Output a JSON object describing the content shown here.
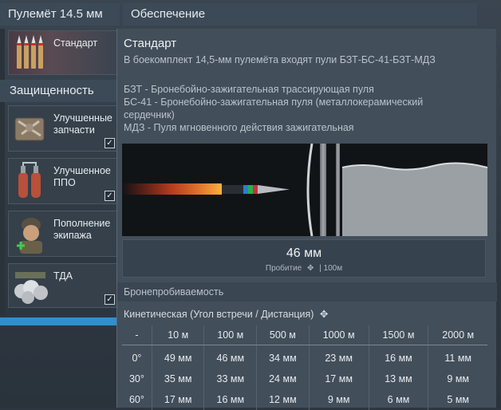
{
  "header": {
    "weapon_title": "Пулемёт 14.5 мм",
    "supply_title": "Обеспечение"
  },
  "belt": {
    "label": "Стандарт"
  },
  "protection": {
    "title": "Защищенность",
    "items": [
      {
        "label": "Улучшенные\nзапчасти",
        "icon": "repair-kit-icon",
        "checked": true
      },
      {
        "label": "Улучшенное\nППО",
        "icon": "fire-extinguisher-icon",
        "checked": true
      },
      {
        "label": "Пополнение\nэкипажа",
        "icon": "crew-replenish-icon",
        "checked": false
      },
      {
        "label": "ТДА",
        "icon": "smoke-system-icon",
        "checked": true
      }
    ]
  },
  "tooltip": {
    "title": "Стандарт",
    "subtitle": "В боекомплект 14,5-мм пулемёта входят пули БЗТ-БС-41-БЗТ-МДЗ",
    "desc": [
      "БЗТ - Бронебойно-зажигательная трассирующая пуля",
      "БС-41 - Бронебойно-зажигательная пуля (металлокерамический\nсердечник)",
      "МДЗ - Пуля мгновенного действия зажигательная"
    ],
    "penetration_value": "46 мм",
    "penetration_caption_left": "Пробитие",
    "penetration_caption_right": "| 100м",
    "armor_title": "Бронепробиваемость",
    "kinetic_title": "Кинетическая (Угол встречи / Дистанция)",
    "table": {
      "headers": [
        "-",
        "10 м",
        "100 м",
        "500 м",
        "1000 м",
        "1500 м",
        "2000 м"
      ],
      "rows": [
        [
          "0°",
          "49 мм",
          "46 мм",
          "34 мм",
          "23 мм",
          "16 мм",
          "11 мм"
        ],
        [
          "30°",
          "35 мм",
          "33 мм",
          "24 мм",
          "17 мм",
          "13 мм",
          "9 мм"
        ],
        [
          "60°",
          "17 мм",
          "16 мм",
          "12 мм",
          "9 мм",
          "6 мм",
          "5 мм"
        ]
      ]
    }
  }
}
